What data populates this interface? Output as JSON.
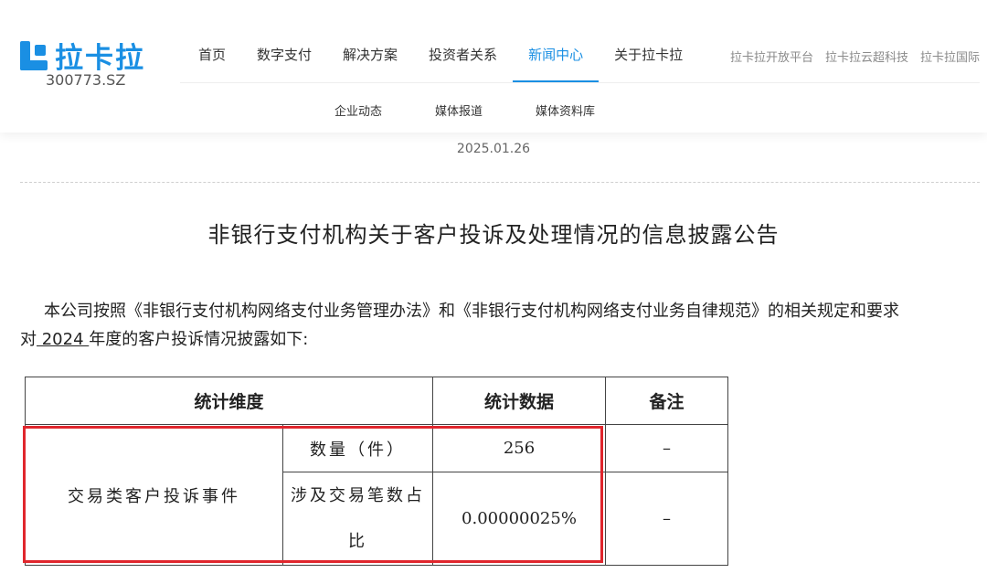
{
  "header": {
    "logo_text": "拉卡拉",
    "stock_code": "300773.SZ",
    "nav": [
      "首页",
      "数字支付",
      "解决方案",
      "投资者关系",
      "新闻中心",
      "关于拉卡拉"
    ],
    "active_nav": "新闻中心",
    "right_links": [
      "拉卡拉开放平台",
      "拉卡拉云超科技",
      "拉卡拉国际"
    ],
    "subnav": [
      "企业动态",
      "媒体报道",
      "媒体资料库"
    ]
  },
  "article": {
    "date": "2025.01.26",
    "title": "非银行支付机构关于客户投诉及处理情况的信息披露公告",
    "para_line1": "本公司按照《非银行支付机构网络支付业务管理办法》和《非银行支付机构网络支付业务自律规范》的相关规定和要求",
    "para_prefix": "对",
    "para_year": " 2024 ",
    "para_suffix": "年度的客户投诉情况披露如下:"
  },
  "table": {
    "headers": [
      "统计维度",
      "统计数据",
      "备注"
    ],
    "group_label": "交易类客户投诉事件",
    "rows": [
      {
        "dimension": "数量（件）",
        "value": "256",
        "note": "–"
      },
      {
        "dimension_line1": "涉及交易笔数占",
        "dimension_line2": "比",
        "value": "0.00000025%",
        "note": "–"
      }
    ]
  },
  "colors": {
    "brand": "#1a8fe3",
    "highlight_box": "#e0262d"
  }
}
